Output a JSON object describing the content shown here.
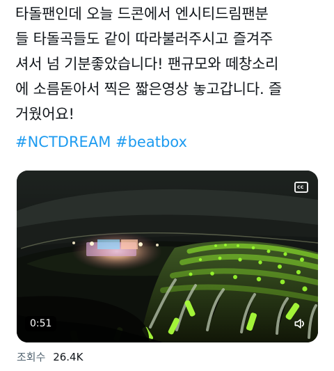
{
  "tweet": {
    "text_lines": [
      "타돌팬인데 오늘 드콘에서 엔시티드림팬분",
      "들 타돌곡들도 같이 따라불러주시고 즐겨주",
      "셔서 넘 기분좋았습니다! 팬규모와 떼창소리",
      "에 소름돋아서 찍은 짧은영상 놓고갑니다. 즐",
      "거웠어요!"
    ],
    "hashtags": [
      "#NCTDREAM",
      "#beatbox"
    ]
  },
  "media": {
    "duration": "0:51",
    "icons": {
      "captions": "closed-captions-icon",
      "volume": "volume-icon"
    }
  },
  "stats": {
    "views_label": "조회수",
    "views_count": "26.4K"
  },
  "colors": {
    "hashtag": "#1d9bf0",
    "text": "#0f1419",
    "muted": "#536471",
    "lightstick_green": "#9cff2e"
  }
}
